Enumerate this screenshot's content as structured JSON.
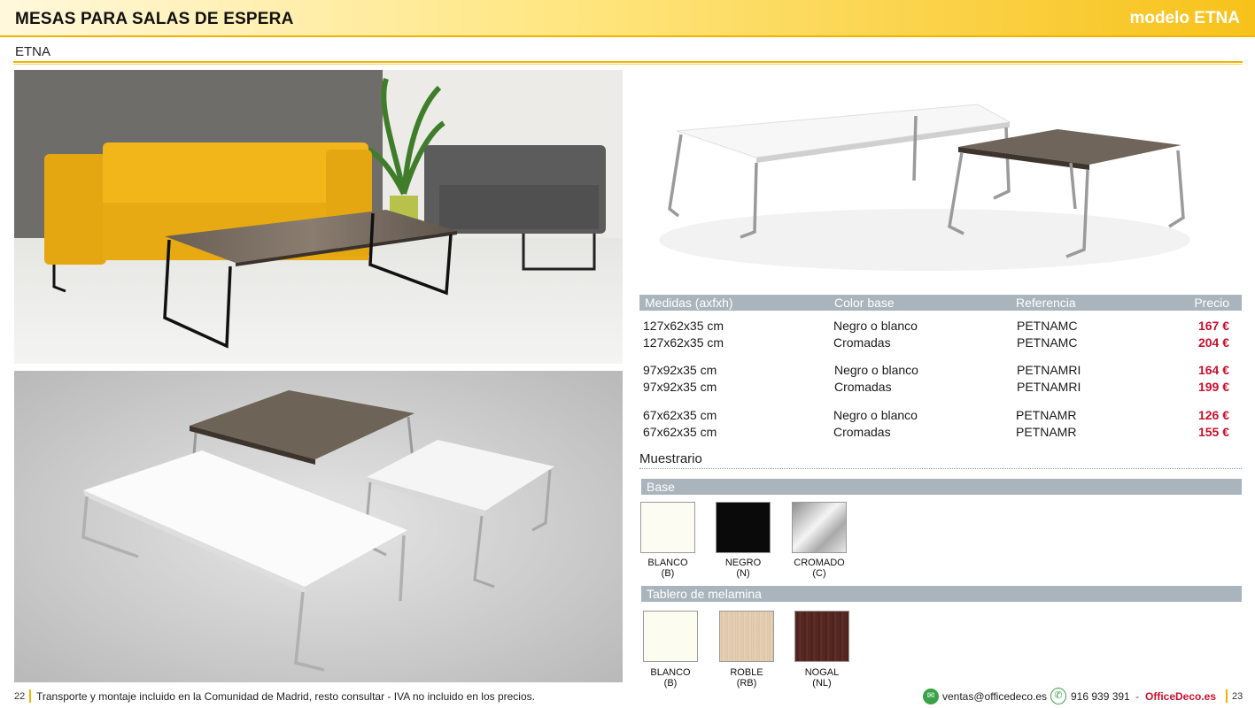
{
  "header": {
    "title": "MESAS PARA SALAS DE ESPERA",
    "model": "modelo ETNA"
  },
  "subtitle": "ETNA",
  "table": {
    "headers": {
      "size": "Medidas (axfxh)",
      "color": "Color base",
      "ref": "Referencia",
      "price": "Precio"
    },
    "rows": [
      {
        "size": "127x62x35 cm",
        "color": "Negro o blanco",
        "ref": "PETNAMC",
        "price": "167 €"
      },
      {
        "size": "127x62x35 cm",
        "color": "Cromadas",
        "ref": "PETNAMC",
        "price": "204 €"
      },
      {
        "size": "97x92x35 cm",
        "color": "Negro o blanco",
        "ref": "PETNAMRI",
        "price": "164 €"
      },
      {
        "size": "97x92x35 cm",
        "color": "Cromadas",
        "ref": "PETNAMRI",
        "price": "199 €"
      },
      {
        "size": "67x62x35 cm",
        "color": "Negro o blanco",
        "ref": "PETNAMR",
        "price": "126 €"
      },
      {
        "size": "67x62x35 cm",
        "color": "Cromadas",
        "ref": "PETNAMR",
        "price": "155 €"
      }
    ]
  },
  "muestrario": "Muestrario",
  "base": {
    "title": "Base",
    "items": [
      {
        "name": "BLANCO",
        "code": "(B)",
        "color": "#fdfcf2"
      },
      {
        "name": "NEGRO",
        "code": "(N)",
        "color": "#0a0a0a"
      },
      {
        "name": "CROMADO",
        "code": "(C)",
        "color": "#c7c7c7"
      }
    ]
  },
  "tablero": {
    "title": "Tablero de melamina",
    "items": [
      {
        "name": "BLANCO",
        "code": "(B)",
        "color": "#fdfcf0"
      },
      {
        "name": "ROBLE",
        "code": "(RB)",
        "color": "#e3cdb0"
      },
      {
        "name": "NOGAL",
        "code": "(NL)",
        "color": "#5a2a22"
      }
    ]
  },
  "footer": {
    "page_left": "22",
    "page_right": "23",
    "legal": "Transporte y montaje incluido en la Comunidad de Madrid, resto consultar - IVA no incluido en los precios.",
    "email": "ventas@officedeco.es",
    "phone": "916 939 391",
    "dash": "-",
    "brand": "OfficeDeco.es"
  },
  "colors": {
    "accent": "#f2b300",
    "price_red": "#c8102e",
    "table_header": "#a9b4bd"
  }
}
